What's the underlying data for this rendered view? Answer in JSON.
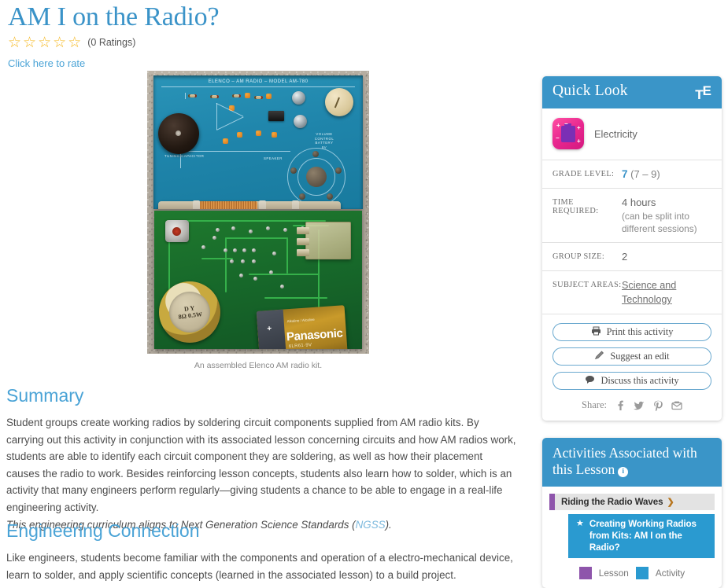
{
  "page": {
    "title": "AM I on the Radio?",
    "rating_count": "(0 Ratings)",
    "rate_link": "Click here to rate",
    "star_glyph": "☆"
  },
  "figure": {
    "caption": "An assembled Elenco AM radio kit.",
    "board_silk_title": "ELENCO  –  AM RADIO  –  MODEL AM-780",
    "tuning_label": "TUNING  CAPACITOR",
    "volume_label": "VOLUME\nCONTROL\nBATTERY\n9V",
    "speaker_label": "SPEAKER",
    "speaker_spec": "D Y\n8Ω 0.5W",
    "battery_brand": "Panasonic",
    "battery_model": "6LR61·9V",
    "battery_top": "Alkaline / Alcaline"
  },
  "sections": [
    {
      "heading": "Summary",
      "body": "Student groups create working radios by soldering circuit components supplied from AM radio kits. By carrying out this activity in conjunction with its associated lesson concerning circuits and how AM radios work, students are able to identify each circuit component they are soldering, as well as how their placement causes the radio to work. Besides reinforcing lesson concepts, students also learn how to solder, which is an activity that many engineers perform regularly—giving students a chance to be able to engage in a real-life engineering activity.",
      "ngss_prefix": "This engineering curriculum aligns to Next Generation Science Standards (",
      "ngss_link": "NGSS",
      "ngss_suffix": ")."
    },
    {
      "heading": "Engineering Connection",
      "body": "Like engineers, students become familiar with the components and operation of a electro-mechanical device, learn to solder, and apply scientific concepts (learned in the associated lesson) to a build project."
    }
  ],
  "quick_look": {
    "title": "Quick Look",
    "logo": "T",
    "logo_sup": "E",
    "subject_icon_name": "electricity-icon",
    "subject_name": "Electricity",
    "rows": [
      {
        "label": "GRADE LEVEL:",
        "value_primary": "7",
        "value_secondary": " (7 – 9)",
        "type": "grade"
      },
      {
        "label": "TIME REQUIRED:",
        "value_primary": "4 hours",
        "value_secondary": "(can be split into different sessions)",
        "type": "time"
      },
      {
        "label": "GROUP SIZE:",
        "value_primary": "2",
        "value_secondary": "",
        "type": "plain"
      },
      {
        "label": "SUBJECT AREAS:",
        "value_primary": "Science and Technology",
        "value_secondary": "",
        "type": "link"
      }
    ],
    "buttons": [
      {
        "label": "Print this activity",
        "icon": "printer-icon"
      },
      {
        "label": "Suggest an edit",
        "icon": "pencil-icon"
      },
      {
        "label": "Discuss this activity",
        "icon": "speech-bubble-icon"
      }
    ],
    "share_label": "Share:",
    "share_icons": [
      "facebook-icon",
      "twitter-icon",
      "pinterest-icon",
      "email-icon"
    ]
  },
  "activities": {
    "title": "Activities Associated with this Lesson",
    "info_glyph": "i",
    "lesson": {
      "name": "Riding the Radio Waves",
      "chevron": "❯"
    },
    "activity": {
      "star": "★",
      "name": "Creating Working Radios from Kits: AM I on the Radio?"
    },
    "legend": [
      {
        "label": "Lesson",
        "color": "#8e55ab"
      },
      {
        "label": "Activity",
        "color": "#2a9ad0"
      }
    ]
  },
  "colors": {
    "accent_blue": "#3a95c8",
    "heading_blue": "#4aa3d6",
    "title_blue": "#3a93c8",
    "lesson_purple": "#8e55ab",
    "activity_blue": "#2a9ad0",
    "star_gold": "#f5b820"
  }
}
